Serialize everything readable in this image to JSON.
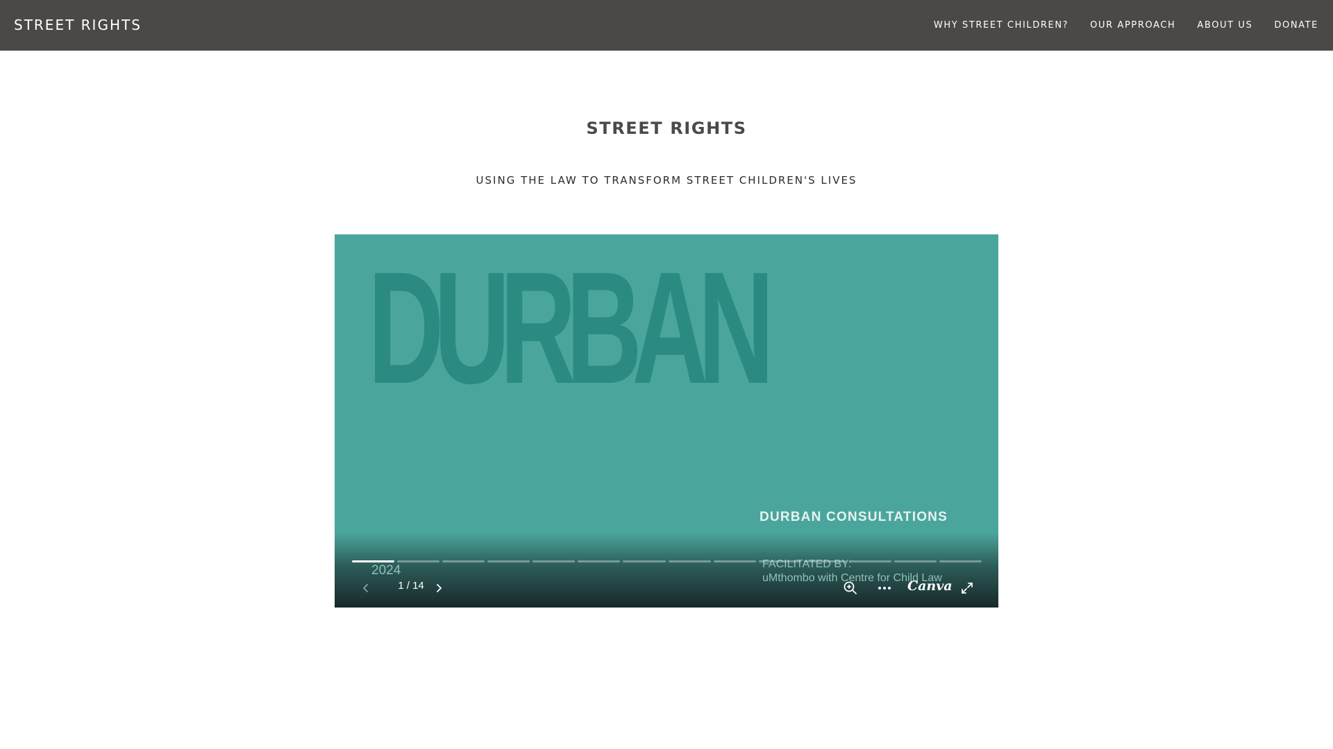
{
  "header": {
    "site_title": "STREET RIGHTS",
    "nav": [
      {
        "label": "WHY STREET CHILDREN?"
      },
      {
        "label": "OUR APPROACH"
      },
      {
        "label": "ABOUT US"
      },
      {
        "label": "DONATE"
      }
    ],
    "background": "#4b4847"
  },
  "main": {
    "title": "STREET RIGHTS",
    "tagline": "USING THE LAW TO TRANSFORM STREET CHILDREN'S LIVES"
  },
  "presentation": {
    "slide": {
      "heading": "DURBAN",
      "subtitle": "DURBAN CONSULTATIONS",
      "year": "2024",
      "facilitated_label": "FACILITATED BY:",
      "facilitated_by": "uMthombo with Centre for Child Law",
      "background": "#4aa69c",
      "heading_color": "#2b8b82"
    },
    "controls": {
      "page_indicator": "1 / 14",
      "current_page": 1,
      "total_pages": 14,
      "brand": "Canva",
      "icons": [
        "chevron-left-icon",
        "chevron-right-icon",
        "zoom-in-icon",
        "more-icon",
        "fullscreen-icon"
      ]
    }
  }
}
